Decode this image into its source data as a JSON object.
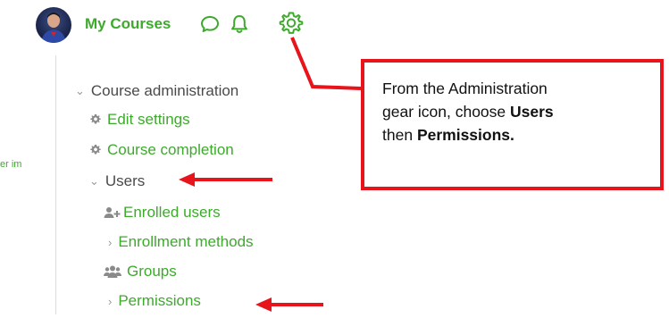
{
  "header": {
    "title": "My Courses",
    "icons": [
      "messages-icon",
      "notifications-bell-icon",
      "settings-gear-icon"
    ]
  },
  "left_cut_text": "er im",
  "nav": {
    "course_admin": "Course administration",
    "edit_settings": "Edit settings",
    "course_completion": "Course completion",
    "users": "Users",
    "enrolled_users": "Enrolled users",
    "enrollment_methods": "Enrollment methods",
    "groups": "Groups",
    "permissions": "Permissions"
  },
  "callout": {
    "line1": "From the Administration",
    "line2_prefix": "gear icon, choose ",
    "line2_bold": "Users",
    "line3_prefix": "then ",
    "line3_bold": "Permissions."
  },
  "colors": {
    "accent_green": "#3daa2c",
    "annotation_red": "#e8141b",
    "text_dark": "#4a4a4a"
  }
}
